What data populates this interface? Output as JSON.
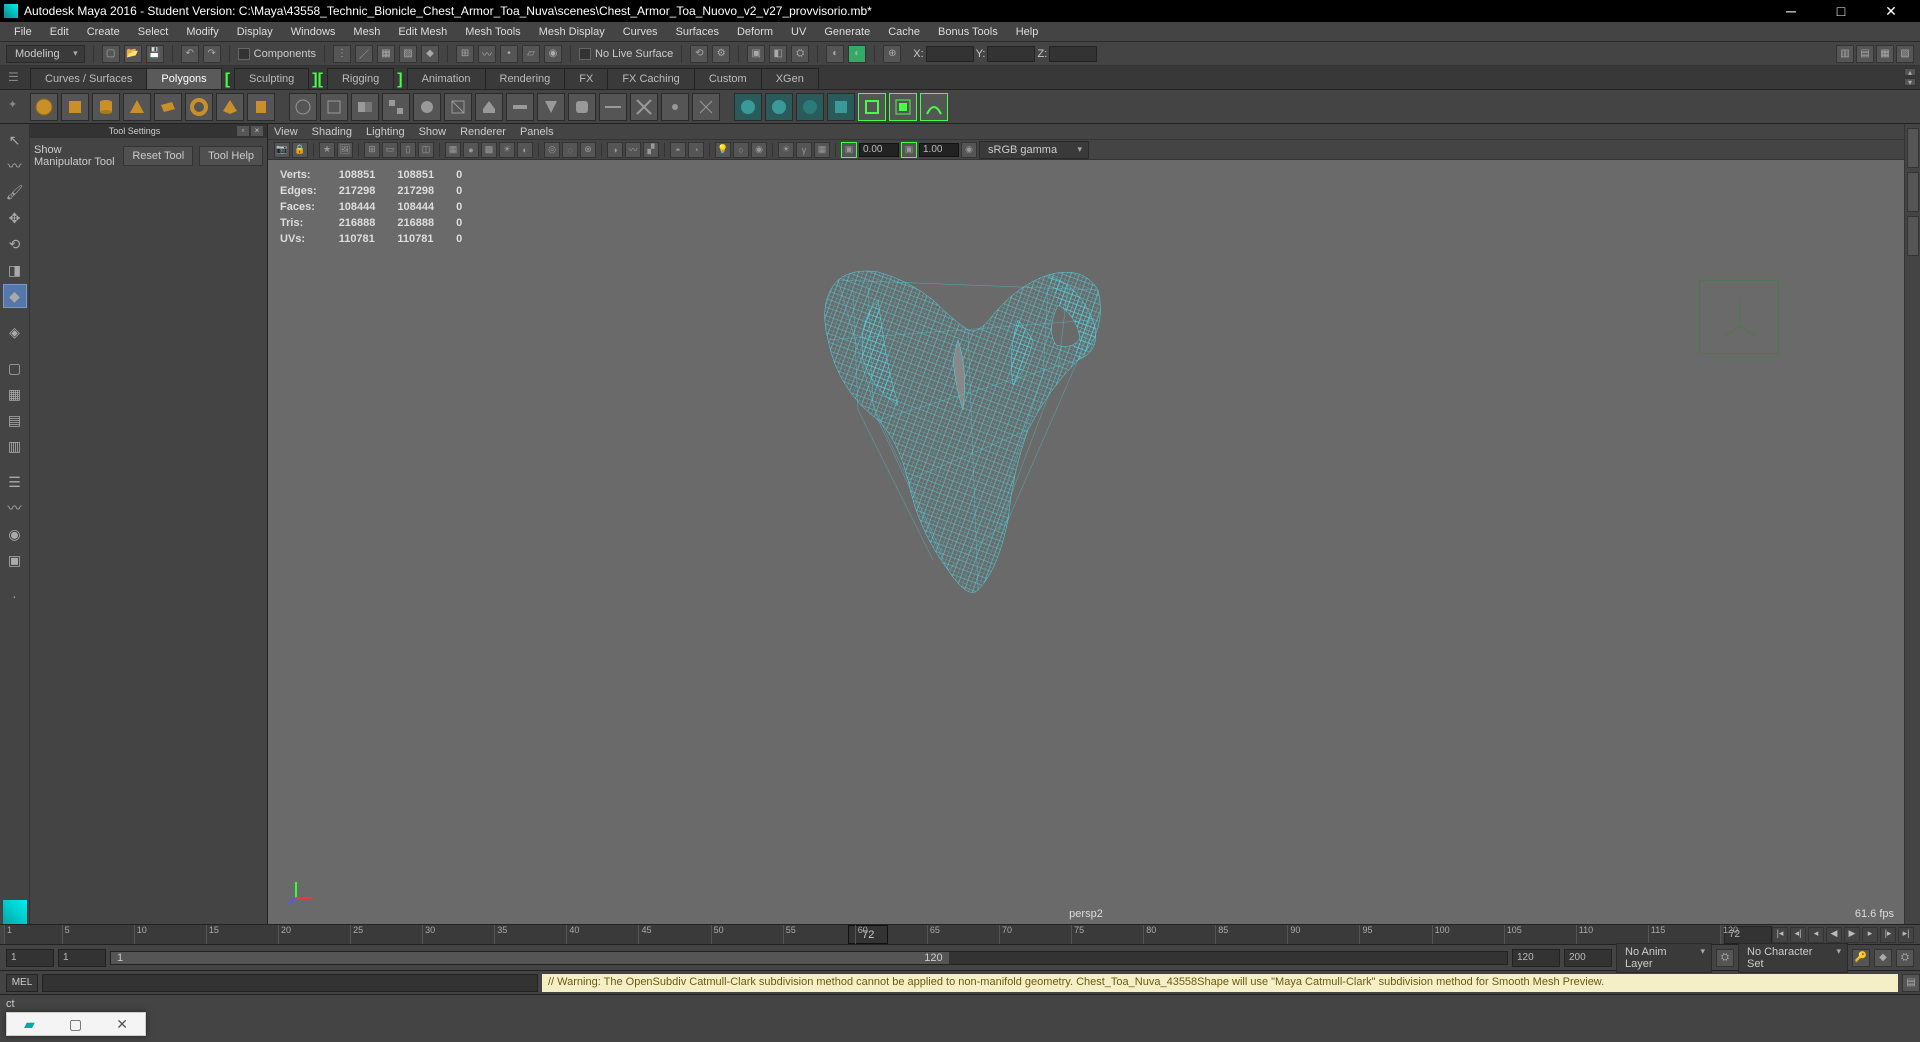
{
  "title": "Autodesk Maya 2016 - Student Version: C:\\Maya\\43558_Technic_Bionicle_Chest_Armor_Toa_Nuva\\scenes\\Chest_Armor_Toa_Nuovo_v2_v27_provvisorio.mb*",
  "menus": [
    "File",
    "Edit",
    "Create",
    "Select",
    "Modify",
    "Display",
    "Windows",
    "Mesh",
    "Edit Mesh",
    "Mesh Tools",
    "Mesh Display",
    "Curves",
    "Surfaces",
    "Deform",
    "UV",
    "Generate",
    "Cache",
    "Bonus Tools",
    "Help"
  ],
  "workspace_mode": "Modeling",
  "components_label": "Components",
  "no_live_surface": "No Live Surface",
  "coords": {
    "x_label": "X:",
    "y_label": "Y:",
    "z_label": "Z:",
    "x": "",
    "y": "",
    "z": ""
  },
  "shelf_tabs": [
    "Curves / Surfaces",
    "Polygons",
    "Sculpting",
    "Rigging",
    "Animation",
    "Rendering",
    "FX",
    "FX Caching",
    "Custom",
    "XGen"
  ],
  "shelf_active": "Polygons",
  "tool_settings": {
    "title": "Tool Settings",
    "tool_name": "Show Manipulator Tool",
    "reset": "Reset Tool",
    "help": "Tool Help"
  },
  "viewport_menus": [
    "View",
    "Shading",
    "Lighting",
    "Show",
    "Renderer",
    "Panels"
  ],
  "viewport_numbers": {
    "a": "0.00",
    "b": "1.00"
  },
  "color_mgmt": "sRGB gamma",
  "hud_rows": [
    {
      "label": "Verts:",
      "a": "108851",
      "b": "108851",
      "c": "0"
    },
    {
      "label": "Edges:",
      "a": "217298",
      "b": "217298",
      "c": "0"
    },
    {
      "label": "Faces:",
      "a": "108444",
      "b": "108444",
      "c": "0"
    },
    {
      "label": "Tris:",
      "a": "216888",
      "b": "216888",
      "c": "0"
    },
    {
      "label": "UVs:",
      "a": "110781",
      "b": "110781",
      "c": "0"
    }
  ],
  "camera_name": "persp2",
  "fps": "61.6 fps",
  "timeline": {
    "ticks": [
      1,
      5,
      10,
      15,
      20,
      25,
      30,
      35,
      40,
      45,
      50,
      55,
      60,
      65,
      70,
      75,
      80,
      85,
      90,
      95,
      100,
      105,
      110,
      115,
      120
    ],
    "current": "72"
  },
  "range": {
    "start_inner": "1",
    "start_outer": "1",
    "end_inner": "120",
    "end_outer": "200",
    "slider_start": "1",
    "slider_end": "120"
  },
  "anim_layer": "No Anim Layer",
  "char_set": "No Character Set",
  "mel_label": "MEL",
  "warning": "// Warning: The OpenSubdiv Catmull-Clark subdivision method cannot be applied to non-manifold geometry. Chest_Toa_Nuva_43558Shape will use \"Maya Catmull-Clark\" subdivision method for Smooth Mesh Preview.",
  "status_text": "ct"
}
